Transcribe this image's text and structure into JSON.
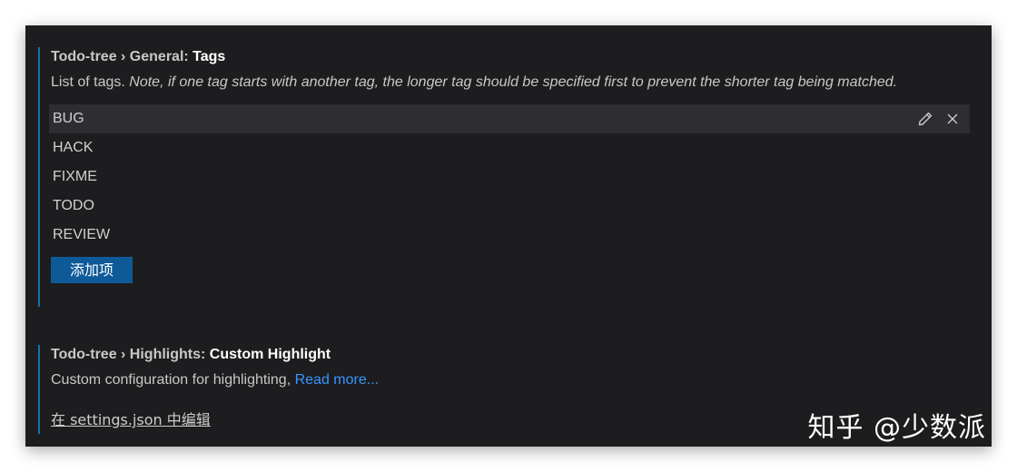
{
  "tags_setting": {
    "category": "Todo-tree › General: ",
    "name": "Tags",
    "desc_plain": "List of tags. ",
    "desc_note": "Note, if one tag starts with another tag, the longer tag should be specified first to prevent the shorter tag being matched.",
    "items": [
      {
        "label": "BUG"
      },
      {
        "label": "HACK"
      },
      {
        "label": "FIXME"
      },
      {
        "label": "TODO"
      },
      {
        "label": "REVIEW"
      }
    ],
    "add_label": "添加项",
    "edit_icon": "pencil-icon",
    "remove_icon": "close-icon"
  },
  "highlight_setting": {
    "category": "Todo-tree › Highlights: ",
    "name": "Custom Highlight",
    "desc_plain": "Custom configuration for highlighting, ",
    "link_text": "Read more...",
    "edit_json": "在 settings.json 中编辑"
  },
  "watermark": "知乎 @少数派",
  "colors": {
    "accent": "#0e5a99",
    "link": "#3794ff",
    "border": "#1b6fa3",
    "background": "#1d1d1f"
  }
}
